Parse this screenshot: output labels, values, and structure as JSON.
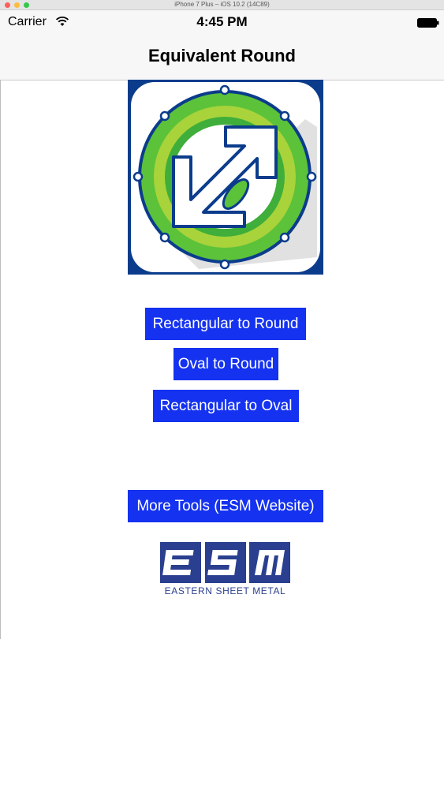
{
  "simulator": {
    "title": "iPhone 7 Plus – iOS 10.2 (14C89)"
  },
  "status_bar": {
    "carrier": "Carrier",
    "time": "4:45 PM"
  },
  "nav": {
    "title": "Equivalent Round"
  },
  "buttons": {
    "rect_to_round": "Rectangular to Round",
    "oval_to_round": "Oval to Round",
    "rect_to_oval": "Rectangular to Oval",
    "more_tools": "More Tools (ESM Website)"
  },
  "esm_logo": {
    "caption": "EASTERN SHEET METAL"
  },
  "colors": {
    "button_blue": "#1432f0",
    "logo_navy": "#0b3c8c",
    "logo_green": "#5cc23a",
    "esm_blue": "#2a3f8f"
  }
}
